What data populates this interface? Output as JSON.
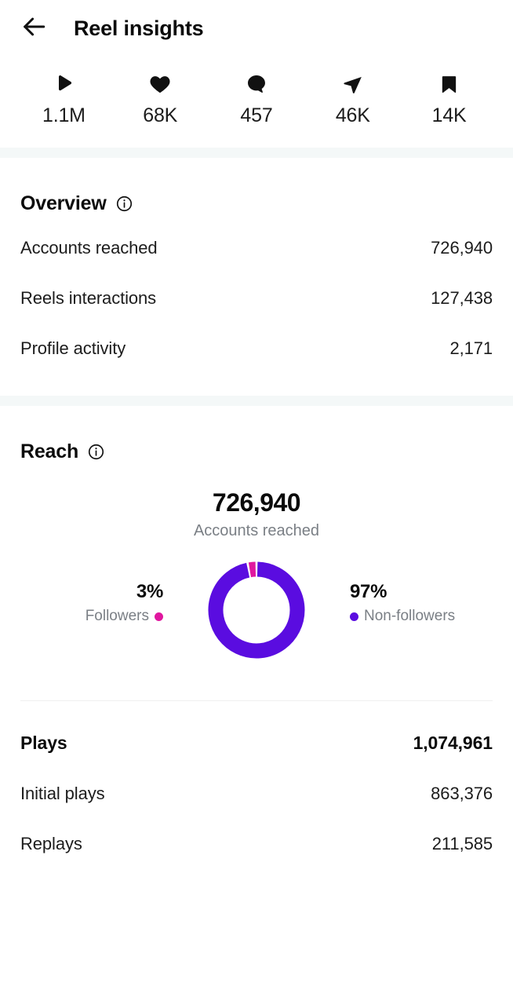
{
  "header": {
    "back_icon": "back-arrow-icon",
    "title": "Reel insights"
  },
  "stats": [
    {
      "icon": "play-icon",
      "value": "1.1M"
    },
    {
      "icon": "heart-icon",
      "value": "68K"
    },
    {
      "icon": "comment-icon",
      "value": "457"
    },
    {
      "icon": "share-icon",
      "value": "46K"
    },
    {
      "icon": "bookmark-icon",
      "value": "14K"
    }
  ],
  "overview": {
    "title": "Overview",
    "info_icon": "info-icon",
    "rows": [
      {
        "label": "Accounts reached",
        "value": "726,940"
      },
      {
        "label": "Reels interactions",
        "value": "127,438"
      },
      {
        "label": "Profile activity",
        "value": "2,171"
      }
    ]
  },
  "reach": {
    "title": "Reach",
    "info_icon": "info-icon",
    "total": "726,940",
    "total_label": "Accounts reached",
    "chart_data": {
      "type": "pie",
      "title": "Accounts reached",
      "categories": [
        "Non-followers",
        "Followers"
      ],
      "values": [
        97,
        3
      ],
      "labels": [
        "97%",
        "3%"
      ],
      "colors": [
        "#5a0ce0",
        "#e0179f"
      ],
      "total": 726940,
      "donut": true,
      "legend_position": "sides"
    },
    "legend_left": {
      "pct": "3%",
      "name": "Followers",
      "color": "#e0179f"
    },
    "legend_right": {
      "pct": "97%",
      "name": "Non-followers",
      "color": "#5a0ce0"
    }
  },
  "plays": {
    "title": "Plays",
    "total": "1,074,961",
    "rows": [
      {
        "label": "Initial plays",
        "value": "863,376"
      },
      {
        "label": "Replays",
        "value": "211,585"
      }
    ]
  }
}
